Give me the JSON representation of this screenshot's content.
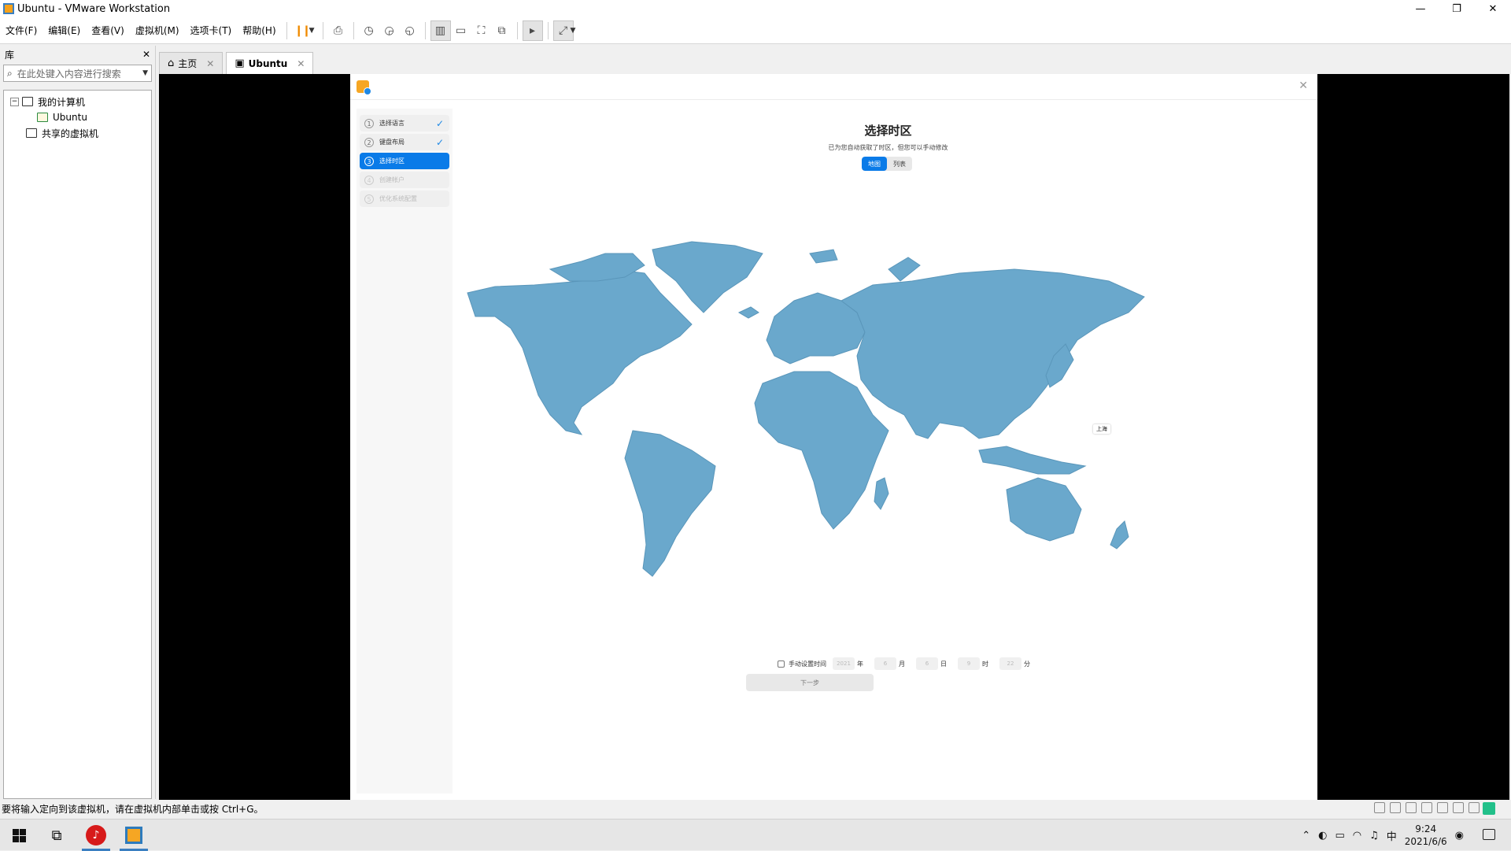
{
  "window": {
    "title": "Ubuntu - VMware Workstation",
    "controls": {
      "minimize": "—",
      "restore": "❐",
      "close": "✕"
    }
  },
  "menu": [
    "文件(F)",
    "编辑(E)",
    "查看(V)",
    "虚拟机(M)",
    "选项卡(T)",
    "帮助(H)"
  ],
  "library": {
    "title": "库",
    "close": "✕",
    "search_placeholder": "在此处键入内容进行搜索",
    "tree": {
      "my_computer": "我的计算机",
      "vm": "Ubuntu",
      "shared": "共享的虚拟机"
    }
  },
  "tabs": [
    {
      "label": "主页",
      "icon": "home-icon",
      "close": "✕"
    },
    {
      "label": "Ubuntu",
      "icon": "vm-icon",
      "close": "✕"
    }
  ],
  "installer": {
    "close": "✕",
    "steps": [
      {
        "num": "1",
        "label": "选择语言",
        "state": "done",
        "check": "✓"
      },
      {
        "num": "2",
        "label": "键盘布局",
        "state": "done",
        "check": "✓"
      },
      {
        "num": "3",
        "label": "选择时区",
        "state": "active",
        "check": ""
      },
      {
        "num": "4",
        "label": "创建帐户",
        "state": "disabled",
        "check": ""
      },
      {
        "num": "5",
        "label": "优化系统配置",
        "state": "disabled",
        "check": ""
      }
    ],
    "title": "选择时区",
    "subtitle": "已为您自动获取了时区，但您可以手动修改",
    "view_toggle": {
      "map": "地图",
      "list": "列表",
      "selected": "map"
    },
    "selected_city": "上海",
    "manual_time": {
      "label": "手动设置时间",
      "year": "2021",
      "year_unit": "年",
      "month": "6",
      "month_unit": "月",
      "day": "6",
      "day_unit": "日",
      "hour": "9",
      "hour_unit": "时",
      "minute": "22",
      "minute_unit": "分"
    },
    "next": "下一步"
  },
  "statusbar": {
    "message": "要将输入定向到该虚拟机，请在虚拟机内部单击或按 Ctrl+G。"
  },
  "taskbar": {
    "time": "9:24",
    "date": "2021/6/6",
    "ime": "中"
  },
  "colors": {
    "accent": "#0a7be8",
    "map_land": "#6aa8cc",
    "pause": "#f08a00"
  }
}
